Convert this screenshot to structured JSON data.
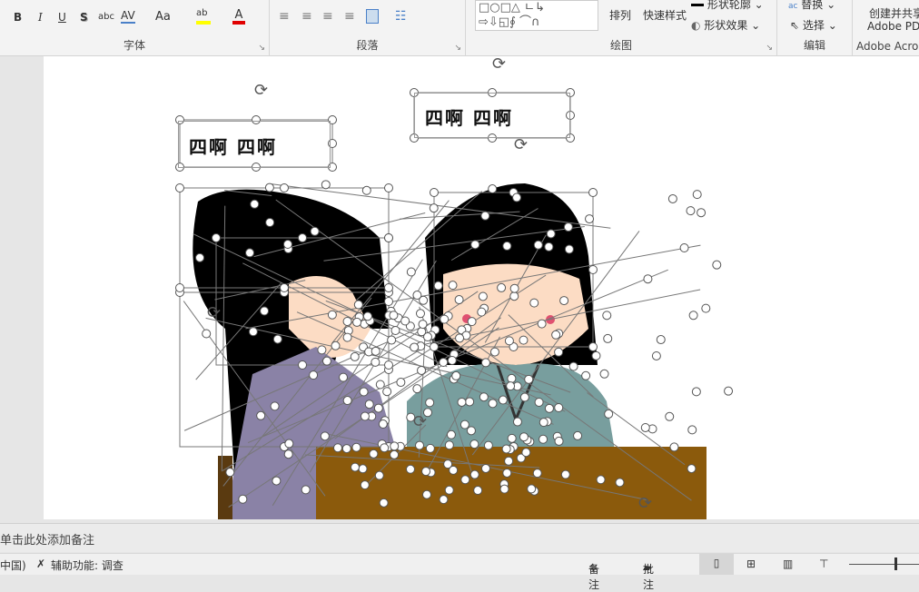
{
  "ribbon": {
    "font_group": {
      "label": "字体",
      "bold": "B",
      "italic": "I",
      "underline": "U",
      "shadow": "S",
      "strike": "abc",
      "spacing": "AV",
      "case": "Aa",
      "highlight_color": "#ffff00",
      "font_color": "#e00000"
    },
    "paragraph_group": {
      "label": "段落"
    },
    "drawing_group": {
      "label": "绘图",
      "arrange": "排列",
      "quick_styles": "快速样式",
      "shape_outline": "形状轮廓",
      "shape_effects": "形状效果"
    },
    "editing_group": {
      "label": "编辑",
      "replace": "替换",
      "select": "选择"
    },
    "adobe_group": {
      "label": "Adobe Acro",
      "create_share": "创建并共享",
      "adobe_pdf": "Adobe PD"
    }
  },
  "slide": {
    "textbox1": "四啊 四啊",
    "textbox2": "四啊 四啊"
  },
  "notes": {
    "placeholder": "单击此处添加备注"
  },
  "status": {
    "language": "中国)",
    "accessibility": "辅助功能: 调查",
    "notes_btn": "备注",
    "comments_btn": "批注"
  }
}
